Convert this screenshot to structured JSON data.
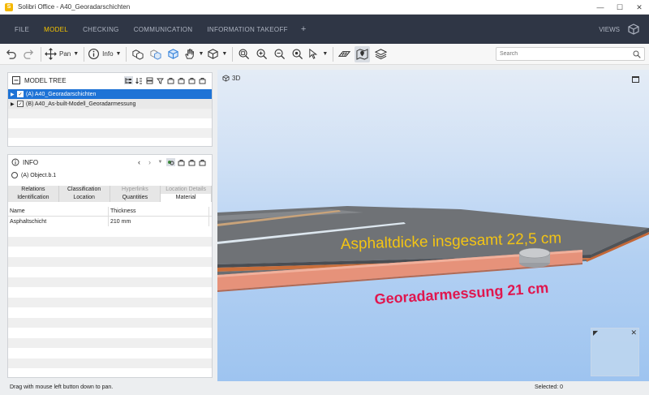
{
  "window": {
    "title": "Solibri Office - A40_Georadarschichten",
    "app_logo": "S",
    "controls": {
      "minimize": "—",
      "maximize": "☐",
      "close": "✕"
    }
  },
  "menu": {
    "items": [
      "FILE",
      "MODEL",
      "CHECKING",
      "COMMUNICATION",
      "INFORMATION TAKEOFF"
    ],
    "active": "MODEL",
    "plus": "+",
    "views_label": "VIEWS"
  },
  "toolbar": {
    "pan_label": "Pan",
    "info_label": "Info",
    "search_placeholder": "Search"
  },
  "model_tree": {
    "title": "MODEL TREE",
    "items": [
      {
        "label": "(A) A40_Georadarschichten",
        "selected": true
      },
      {
        "label": "(B) A40_As-built-Modell_Georadarmessung",
        "selected": false
      }
    ]
  },
  "info": {
    "title": "INFO",
    "object": "(A) Object.b.1",
    "tabs_row1": [
      "Relations",
      "Classification",
      "Hyperlinks",
      "Location Details"
    ],
    "tabs_row2": [
      "Identification",
      "Location",
      "Quantities",
      "Material"
    ],
    "active_tab": "Material",
    "table": {
      "headers": [
        "Name",
        "Thickness"
      ],
      "rows": [
        [
          "Asphaltschicht",
          "210 mm"
        ]
      ]
    }
  },
  "view": {
    "label": "3D",
    "annotation_1": "Asphaltdicke insgesamt 22,5 cm",
    "annotation_2": "Georadarmessung 21 cm",
    "navcube_resize": "◤",
    "navcube_close": "✕",
    "colors": {
      "annotation_1": "#f3c414",
      "annotation_2": "#e0164e"
    }
  },
  "status": {
    "hint": "Drag with mouse left button down to pan.",
    "selected": "Selected: 0"
  }
}
